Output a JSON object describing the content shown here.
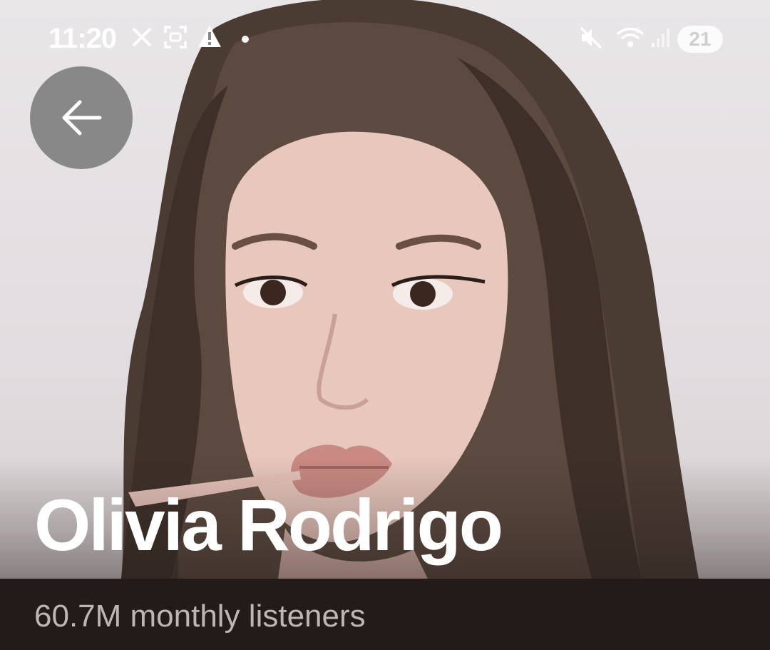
{
  "status_bar": {
    "time": "11:20",
    "left_icons": [
      "x-logo-icon",
      "screenshot-icon",
      "warning-icon",
      "dot-icon"
    ],
    "right_icons": [
      "mute-icon",
      "wifi-icon",
      "signal-icon"
    ],
    "battery": "21"
  },
  "header": {
    "back_icon": "arrow-left-icon"
  },
  "artist": {
    "name": "Olivia Rodrigo",
    "monthly_listeners": "60.7M monthly listeners"
  },
  "colors": {
    "background": "#231b19",
    "name_text": "#ffffff",
    "listeners_text": "#bdb6b3",
    "back_button": "#787878"
  }
}
